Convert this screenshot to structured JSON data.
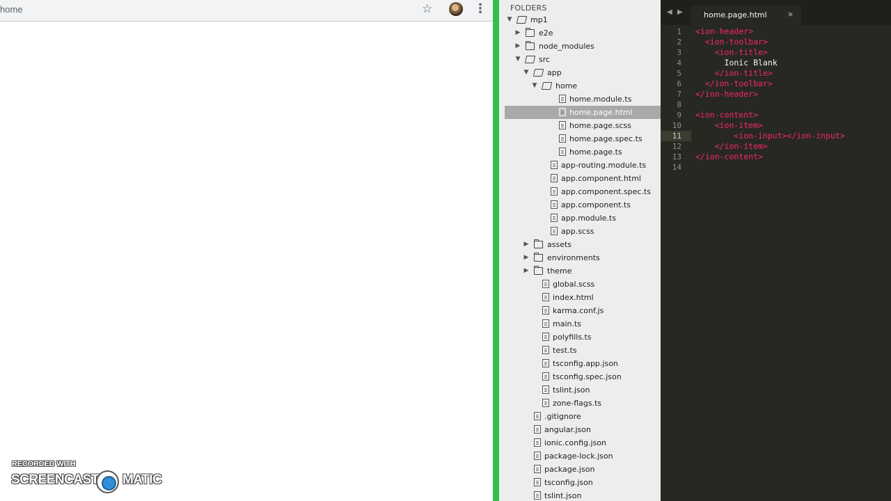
{
  "browser": {
    "address_text": "home",
    "star_icon": "star-icon",
    "menu_icon": "kebab-menu-icon"
  },
  "sidebar": {
    "header": "FOLDERS",
    "items": [
      {
        "label": "mp1",
        "kind": "folder-open",
        "depth": 0
      },
      {
        "label": "e2e",
        "kind": "folder",
        "depth": 1
      },
      {
        "label": "node_modules",
        "kind": "folder",
        "depth": 1
      },
      {
        "label": "src",
        "kind": "folder-open",
        "depth": 1
      },
      {
        "label": "app",
        "kind": "folder-open",
        "depth": 2
      },
      {
        "label": "home",
        "kind": "folder-open",
        "depth": 3
      },
      {
        "label": "home.module.ts",
        "kind": "file",
        "depth": 4
      },
      {
        "label": "home.page.html",
        "kind": "file",
        "depth": 4,
        "selected": true
      },
      {
        "label": "home.page.scss",
        "kind": "file",
        "depth": 4
      },
      {
        "label": "home.page.spec.ts",
        "kind": "file",
        "depth": 4
      },
      {
        "label": "home.page.ts",
        "kind": "file",
        "depth": 4
      },
      {
        "label": "app-routing.module.ts",
        "kind": "file",
        "depth": 3
      },
      {
        "label": "app.component.html",
        "kind": "file",
        "depth": 3
      },
      {
        "label": "app.component.spec.ts",
        "kind": "file",
        "depth": 3
      },
      {
        "label": "app.component.ts",
        "kind": "file",
        "depth": 3
      },
      {
        "label": "app.module.ts",
        "kind": "file",
        "depth": 3
      },
      {
        "label": "app.scss",
        "kind": "file",
        "depth": 3
      },
      {
        "label": "assets",
        "kind": "folder",
        "depth": 2
      },
      {
        "label": "environments",
        "kind": "folder",
        "depth": 2
      },
      {
        "label": "theme",
        "kind": "folder",
        "depth": 2
      },
      {
        "label": "global.scss",
        "kind": "file",
        "depth": 2
      },
      {
        "label": "index.html",
        "kind": "file",
        "depth": 2
      },
      {
        "label": "karma.conf.js",
        "kind": "file",
        "depth": 2
      },
      {
        "label": "main.ts",
        "kind": "file",
        "depth": 2
      },
      {
        "label": "polyfills.ts",
        "kind": "file",
        "depth": 2
      },
      {
        "label": "test.ts",
        "kind": "file",
        "depth": 2
      },
      {
        "label": "tsconfig.app.json",
        "kind": "file",
        "depth": 2
      },
      {
        "label": "tsconfig.spec.json",
        "kind": "file",
        "depth": 2
      },
      {
        "label": "tslint.json",
        "kind": "file",
        "depth": 2
      },
      {
        "label": "zone-flags.ts",
        "kind": "file",
        "depth": 2
      },
      {
        "label": ".gitignore",
        "kind": "file",
        "depth": 1
      },
      {
        "label": "angular.json",
        "kind": "file",
        "depth": 1
      },
      {
        "label": "ionic.config.json",
        "kind": "file",
        "depth": 1
      },
      {
        "label": "package-lock.json",
        "kind": "file",
        "depth": 1
      },
      {
        "label": "package.json",
        "kind": "file",
        "depth": 1
      },
      {
        "label": "tsconfig.json",
        "kind": "file",
        "depth": 1
      },
      {
        "label": "tslint.json",
        "kind": "file",
        "depth": 1
      }
    ]
  },
  "editor": {
    "tab_title": "home.page.html",
    "tab_close": "×",
    "nav_left": "◀",
    "nav_right": "▶",
    "active_line": 11,
    "lines": [
      [
        {
          "t": "tag",
          "v": "<"
        },
        {
          "t": "tag",
          "v": "ion-header"
        },
        {
          "t": "tag",
          "v": ">"
        }
      ],
      [
        {
          "t": "txt",
          "v": "  "
        },
        {
          "t": "tag",
          "v": "<ion-toolbar>"
        }
      ],
      [
        {
          "t": "txt",
          "v": "    "
        },
        {
          "t": "tag",
          "v": "<ion-title>"
        }
      ],
      [
        {
          "t": "txt",
          "v": "      Ionic Blank"
        }
      ],
      [
        {
          "t": "txt",
          "v": "    "
        },
        {
          "t": "tag",
          "v": "</ion-title>"
        }
      ],
      [
        {
          "t": "txt",
          "v": "  "
        },
        {
          "t": "tag",
          "v": "</ion-toolbar>"
        }
      ],
      [
        {
          "t": "tag",
          "v": "</ion-header>"
        }
      ],
      [],
      [
        {
          "t": "tag",
          "v": "<ion-content>"
        }
      ],
      [
        {
          "t": "txt",
          "v": "    "
        },
        {
          "t": "tag",
          "v": "<ion-item>"
        }
      ],
      [
        {
          "t": "txt",
          "v": "        "
        },
        {
          "t": "tag",
          "v": "<ion-input></ion-input>"
        }
      ],
      [
        {
          "t": "txt",
          "v": "    "
        },
        {
          "t": "tag",
          "v": "</ion-item>"
        }
      ],
      [
        {
          "t": "tag",
          "v": "</ion-content>"
        }
      ],
      []
    ]
  },
  "watermark": {
    "line1": "RECORDED WITH",
    "word1": "SCREENCAST",
    "word2": "MATIC"
  }
}
